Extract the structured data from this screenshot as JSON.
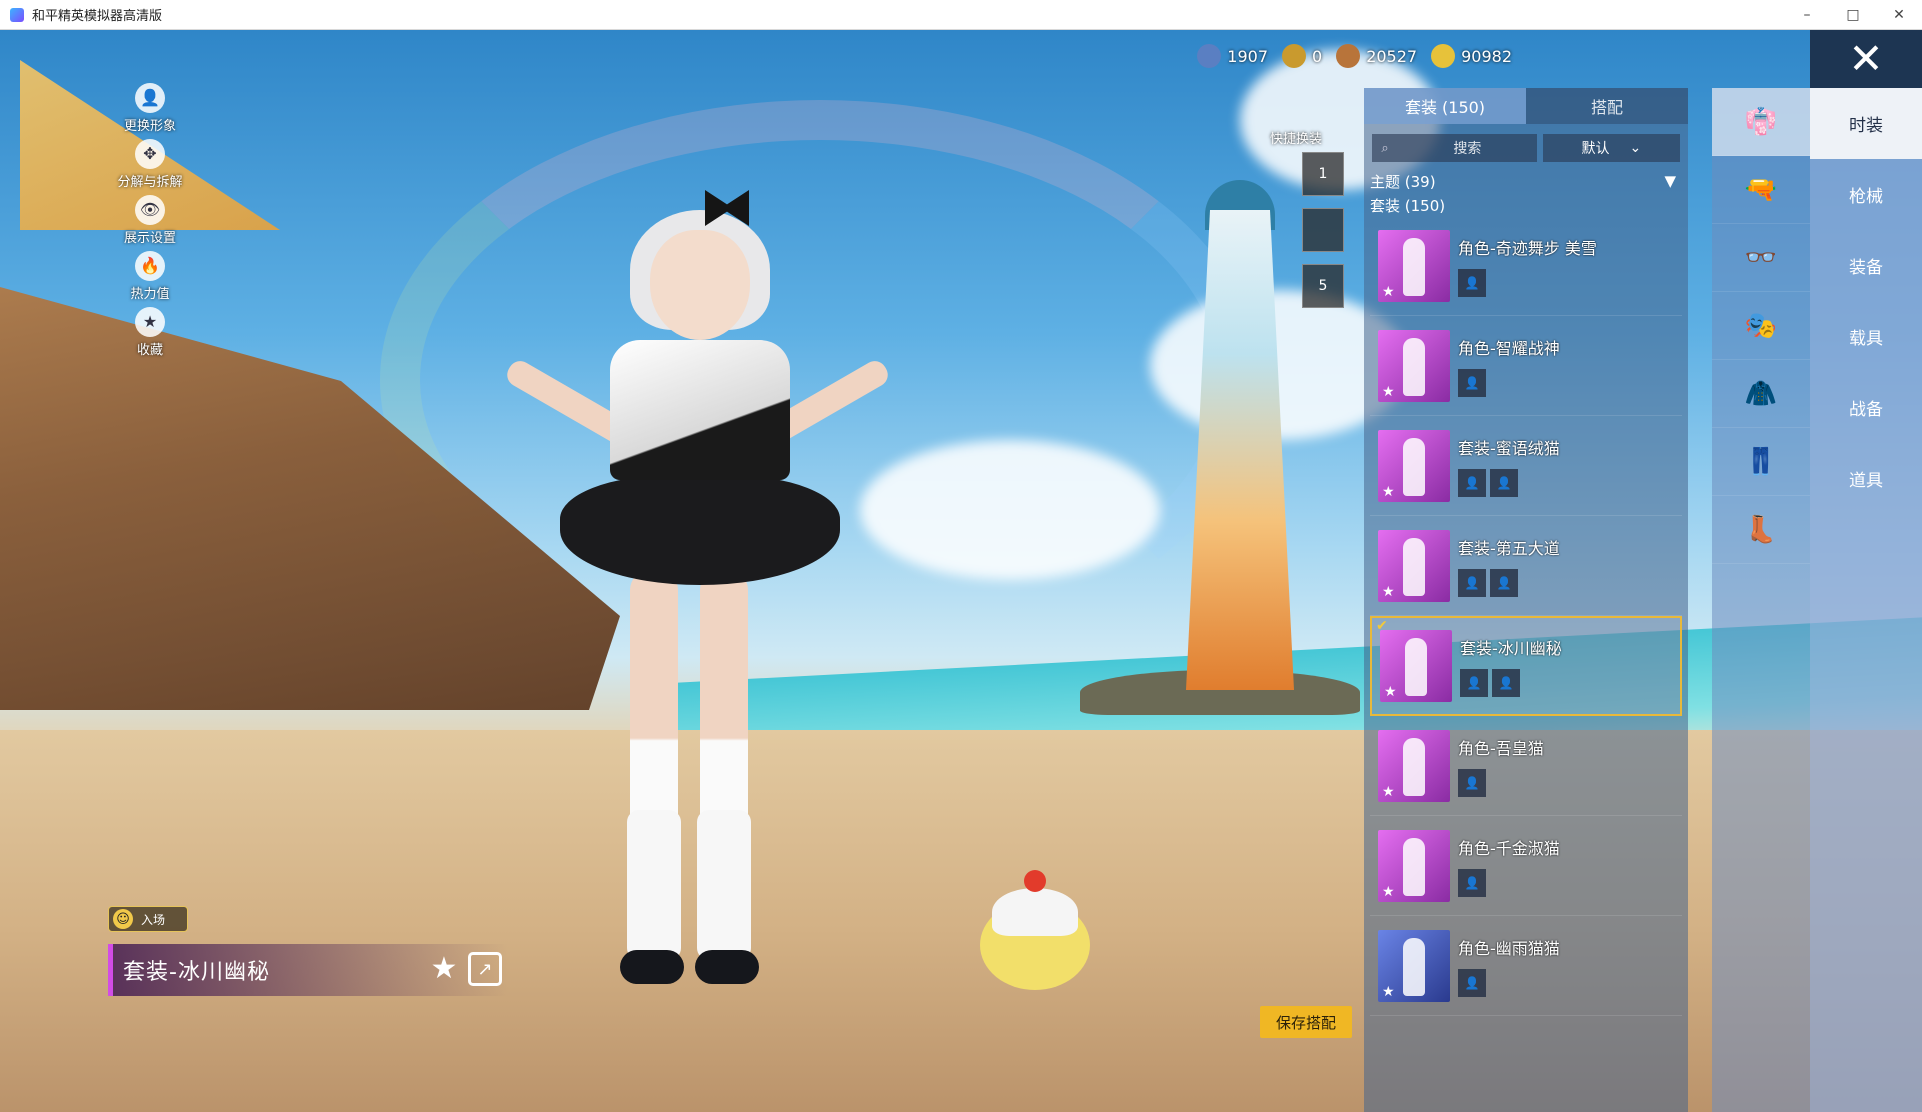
{
  "window": {
    "title": "和平精英模拟器高清版",
    "minimize": "–",
    "maximize": "□",
    "close": "✕"
  },
  "side_menu": [
    {
      "label": "更换形象",
      "icon": "person-icon",
      "glyph": "👤"
    },
    {
      "label": "分解与拆解",
      "icon": "puzzle-icon",
      "glyph": "✥"
    },
    {
      "label": "展示设置",
      "icon": "eye-icon",
      "glyph": "👁"
    },
    {
      "label": "热力值",
      "icon": "fire-icon",
      "glyph": "🔥"
    },
    {
      "label": "收藏",
      "icon": "medal-icon",
      "glyph": "★"
    }
  ],
  "entry_tag": {
    "label": "入场",
    "face": "☺"
  },
  "outfit": {
    "name": "套装-冰川幽秘",
    "favorite_glyph": "★",
    "share_glyph": "↗"
  },
  "currency": [
    {
      "value": "1907",
      "color": "#5a7fc2",
      "icon": "coin-blue-icon"
    },
    {
      "value": "0",
      "color": "#c99a2e",
      "icon": "coin-gold-icon"
    },
    {
      "value": "20527",
      "color": "#b8743a",
      "icon": "coin-bronze-icon"
    },
    {
      "value": "90982",
      "color": "#e7c23a",
      "icon": "coin-yellow-icon"
    }
  ],
  "close_glyph": "✕",
  "quick_swap": {
    "label": "快捷换装",
    "slots": [
      "1",
      "",
      "5"
    ]
  },
  "panel": {
    "tabs": [
      "套装 (150)",
      "搭配"
    ],
    "search_placeholder": "搜索",
    "sort_label": "默认",
    "theme_filter": "主题 (39)",
    "suit_filter": "套装 (150)",
    "items": [
      {
        "name": "角色-奇迹舞步 美雪",
        "minis": 1,
        "selected": false,
        "style": "pink"
      },
      {
        "name": "角色-智耀战神",
        "minis": 1,
        "selected": false,
        "style": "pink"
      },
      {
        "name": "套装-蜜语绒猫",
        "minis": 2,
        "selected": false,
        "style": "pink"
      },
      {
        "name": "套装-第五大道",
        "minis": 2,
        "selected": false,
        "style": "pink"
      },
      {
        "name": "套装-冰川幽秘",
        "minis": 2,
        "selected": true,
        "style": "pink"
      },
      {
        "name": "角色-吾皇猫",
        "minis": 1,
        "selected": false,
        "style": "pink"
      },
      {
        "name": "角色-千金淑猫",
        "minis": 1,
        "selected": false,
        "style": "pink"
      },
      {
        "name": "角色-幽雨猫猫",
        "minis": 1,
        "selected": false,
        "style": "blue"
      }
    ]
  },
  "save_button": "保存搭配",
  "category_icons": [
    "outfit-icon",
    "gun-icon",
    "glasses-icon",
    "mask-icon",
    "jacket-icon",
    "pants-icon",
    "shoes-icon"
  ],
  "category_glyphs": [
    "👘",
    "🔫",
    "👓",
    "🎭",
    "🧥",
    "👖",
    "👢"
  ],
  "categories": [
    "时装",
    "枪械",
    "装备",
    "载具",
    "战备",
    "道具"
  ]
}
